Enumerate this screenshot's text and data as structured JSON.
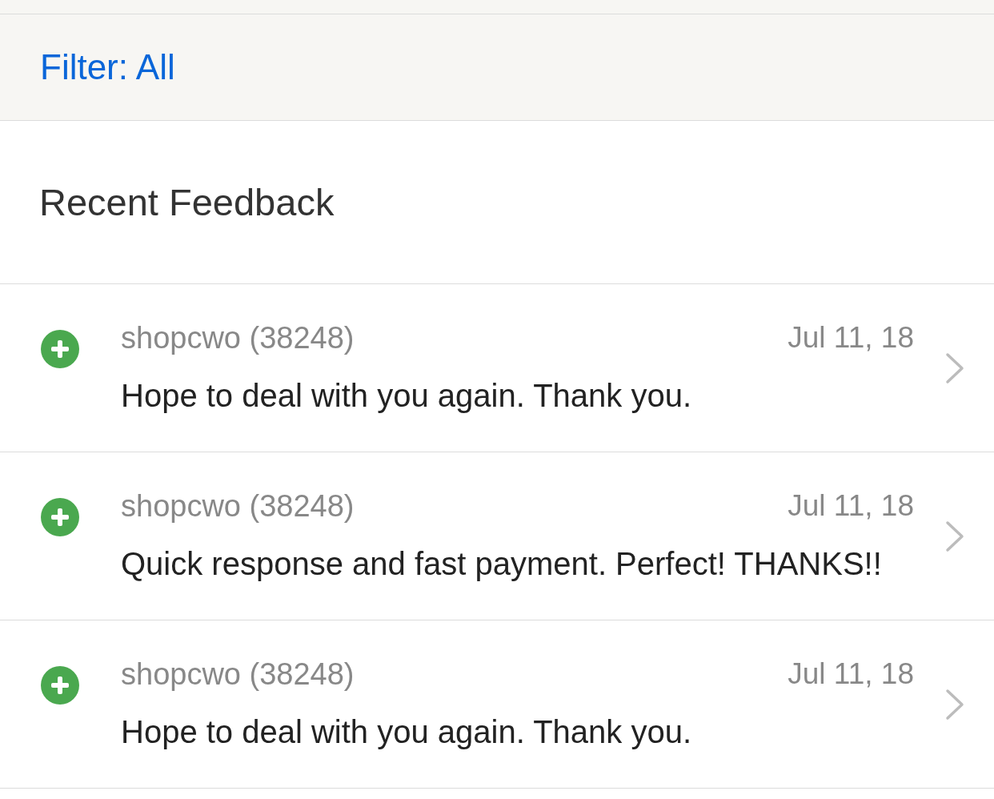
{
  "filter": {
    "label": "Filter: All"
  },
  "section": {
    "title": "Recent Feedback"
  },
  "feedback": [
    {
      "kind": "positive",
      "user": "shopcwo (38248)",
      "date": "Jul 11, 18",
      "comment": "Hope to deal with you again. Thank you."
    },
    {
      "kind": "positive",
      "user": "shopcwo (38248)",
      "date": "Jul 11, 18",
      "comment": "Quick response and fast payment. Perfect! THANKS!!"
    },
    {
      "kind": "positive",
      "user": "shopcwo (38248)",
      "date": "Jul 11, 18",
      "comment": "Hope to deal with you again. Thank you."
    }
  ]
}
